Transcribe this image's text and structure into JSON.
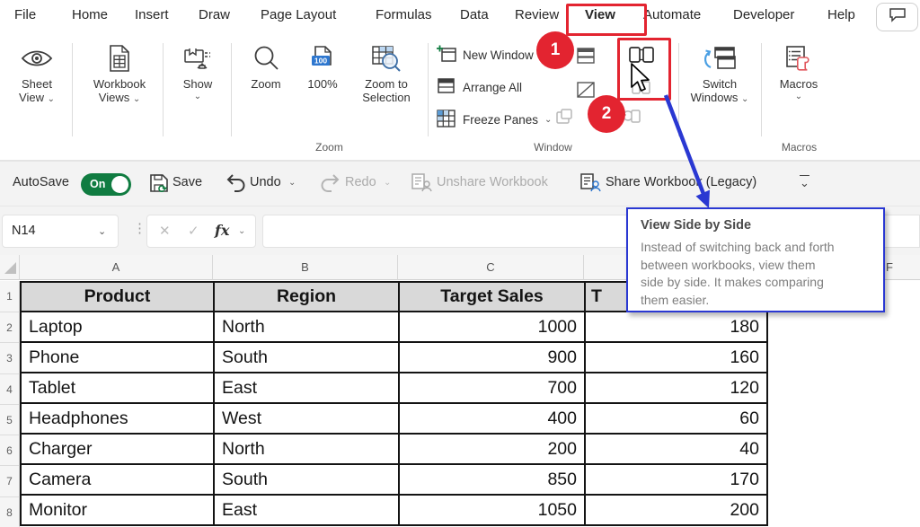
{
  "menu": {
    "tabs": [
      "File",
      "Home",
      "Insert",
      "Draw",
      "Page Layout",
      "Formulas",
      "Data",
      "Review",
      "View",
      "Automate",
      "Developer",
      "Help"
    ],
    "active_tab": "View"
  },
  "ribbon": {
    "sheet_view": "Sheet View",
    "workbook_views": "Workbook Views",
    "show": "Show",
    "zoom": "Zoom",
    "hundred_pct": "100%",
    "zoom_to_selection": "Zoom to Selection",
    "new_window": "New Window",
    "arrange_all": "Arrange All",
    "freeze_panes": "Freeze Panes",
    "switch_windows": "Switch Windows",
    "macros": "Macros",
    "group_zoom": "Zoom",
    "group_window": "Window",
    "group_macros": "Macros"
  },
  "qat": {
    "autosave_label": "AutoSave",
    "autosave_state": "On",
    "save": "Save",
    "undo": "Undo",
    "redo": "Redo",
    "unshare": "Unshare Workbook",
    "share": "Share Workbook (Legacy)"
  },
  "formula": {
    "name_box": "N14",
    "fx": "fx",
    "value": ""
  },
  "steps": {
    "one": "1",
    "two": "2"
  },
  "tooltip": {
    "title": "View Side by Side",
    "body": "Instead of switching back and forth between workbooks, view them side by side. It makes comparing them easier."
  },
  "sheet": {
    "visible_column_letters": [
      "A",
      "B",
      "C",
      "F"
    ],
    "d1_visible_text": "T",
    "header_row": [
      "Product",
      "Region",
      "Target Sales"
    ],
    "row_numbers": [
      "1",
      "2",
      "3",
      "4",
      "5",
      "6",
      "7",
      "8"
    ],
    "rows": [
      {
        "product": "Laptop",
        "region": "North",
        "target_sales": "1000",
        "col_d": "180"
      },
      {
        "product": "Phone",
        "region": "South",
        "target_sales": "900",
        "col_d": "160"
      },
      {
        "product": "Tablet",
        "region": "East",
        "target_sales": "700",
        "col_d": "120"
      },
      {
        "product": "Headphones",
        "region": "West",
        "target_sales": "400",
        "col_d": "60"
      },
      {
        "product": "Charger",
        "region": "North",
        "target_sales": "200",
        "col_d": "40"
      },
      {
        "product": "Camera",
        "region": "South",
        "target_sales": "850",
        "col_d": "170"
      },
      {
        "product": "Monitor",
        "region": "East",
        "target_sales": "1050",
        "col_d": "200"
      }
    ]
  },
  "icons": {
    "sheet_view": "eye",
    "workbook_views": "document-grid",
    "show": "panel-toggles",
    "zoom": "magnifier",
    "hundred_pct": "page-100-badge",
    "zoom_to_selection": "grid-magnifier",
    "new_window": "window-plus",
    "arrange_all": "window-titlebar",
    "freeze_panes": "grid-frozen-cells",
    "split": "window-split",
    "hide": "window-diagonal",
    "view_side_by_side": "two-pages",
    "synchronous_scrolling": "two-pages-gray",
    "reset_window_position": "two-pages-gray",
    "switch_windows": "cascaded-windows-blue-arrow",
    "macros": "list-red-scroll",
    "save": "floppy-sync",
    "undo": "arrow-undo",
    "redo": "arrow-redo",
    "unshare": "sheet-person-gray",
    "share": "sheet-person-blue",
    "comment": "speech-bubble",
    "cursor": "mouse-pointer",
    "select_all": "corner-triangle"
  },
  "colors": {
    "accent_red": "#e32430",
    "callout_blue": "#2a38d2",
    "excel_green": "#107c41",
    "header_fill": "#d9d9d9",
    "badge_blue": "#2e77cf"
  }
}
